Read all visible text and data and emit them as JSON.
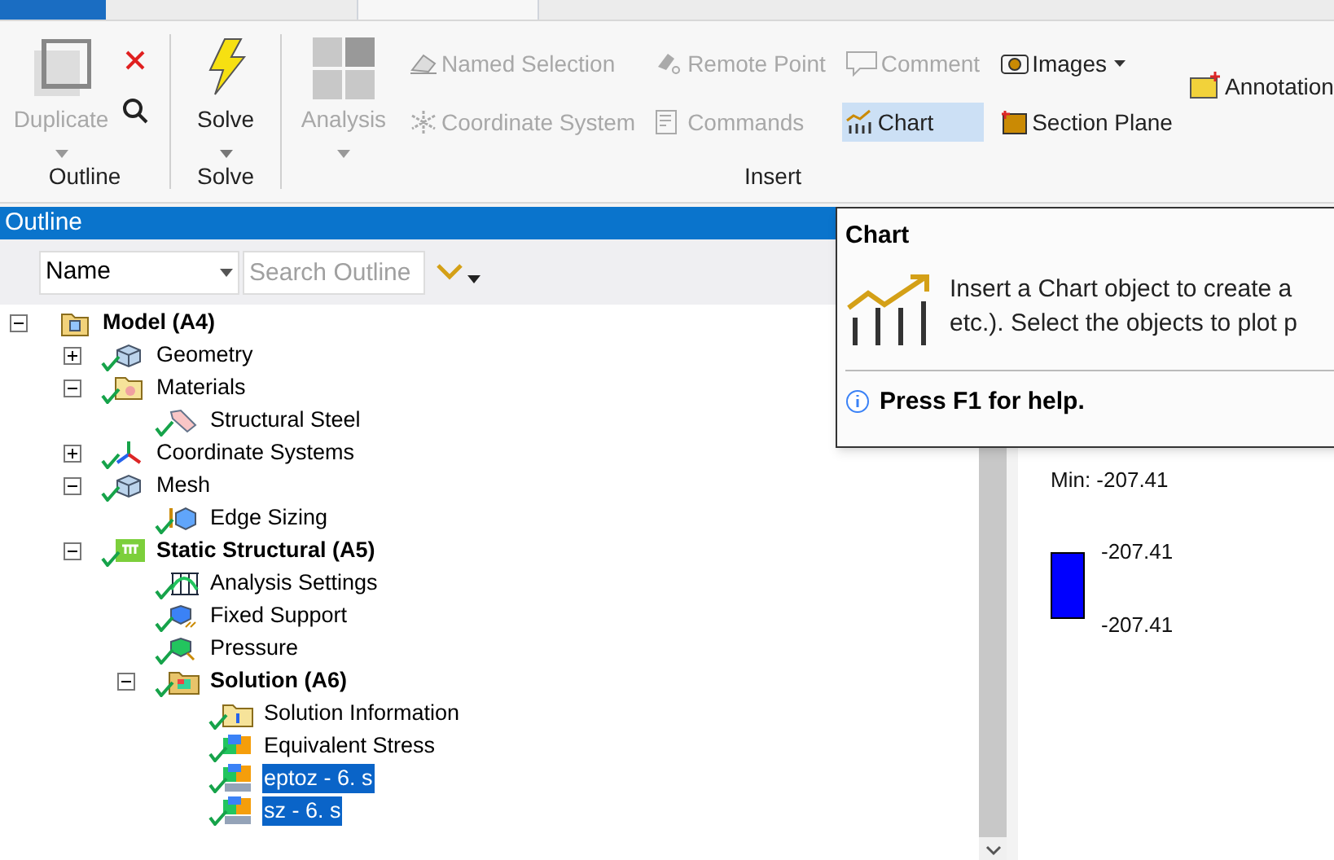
{
  "ribbon": {
    "outline_group": {
      "label": "Outline",
      "duplicate": {
        "label": "Duplicate",
        "disabled": true
      }
    },
    "solve_group": {
      "label": "Solve",
      "solve": {
        "label": "Solve",
        "disabled": false
      }
    },
    "insert_group": {
      "label": "Insert",
      "analysis": {
        "label": "Analysis",
        "disabled": true
      },
      "items": [
        {
          "label": "Named Selection",
          "kind": "named",
          "disabled": true,
          "selected": false
        },
        {
          "label": "Remote Point",
          "kind": "remote",
          "disabled": true,
          "selected": false
        },
        {
          "label": "Comment",
          "kind": "comment",
          "disabled": true,
          "selected": false
        },
        {
          "label": "Images",
          "kind": "images",
          "disabled": false,
          "selected": false
        },
        {
          "label": "Coordinate System",
          "kind": "coord",
          "disabled": true,
          "selected": false
        },
        {
          "label": "Commands",
          "kind": "commands",
          "disabled": true,
          "selected": false
        },
        {
          "label": "Chart",
          "kind": "chart",
          "disabled": false,
          "selected": true
        },
        {
          "label": "Section Plane",
          "kind": "section",
          "disabled": false,
          "selected": false
        }
      ],
      "annotation": {
        "label": "Annotation"
      }
    }
  },
  "outline": {
    "title": "Outline",
    "filter": {
      "value": "Name"
    },
    "search": {
      "placeholder": "Search Outline"
    },
    "tree": [
      {
        "label": "Model (A4)",
        "kind": "model",
        "bold": true,
        "solved": false,
        "expanded": true,
        "selected": false,
        "children": [
          {
            "label": "Geometry",
            "kind": "geometry",
            "bold": false,
            "solved": true,
            "expanded": false,
            "selected": false
          },
          {
            "label": "Materials",
            "kind": "materials",
            "bold": false,
            "solved": true,
            "expanded": true,
            "selected": false,
            "children": [
              {
                "label": "Structural Steel",
                "kind": "tag",
                "bold": false,
                "solved": true,
                "selected": false
              }
            ]
          },
          {
            "label": "Coordinate Systems",
            "kind": "coord",
            "bold": false,
            "solved": true,
            "expanded": false,
            "selected": false
          },
          {
            "label": "Mesh",
            "kind": "geometry",
            "bold": false,
            "solved": true,
            "expanded": true,
            "selected": false,
            "children": [
              {
                "label": "Edge Sizing",
                "kind": "sizing",
                "bold": false,
                "solved": true,
                "selected": false
              }
            ]
          },
          {
            "label": "Static Structural (A5)",
            "kind": "static",
            "bold": true,
            "solved": true,
            "expanded": true,
            "selected": false,
            "children": [
              {
                "label": "Analysis Settings",
                "kind": "settings",
                "bold": false,
                "solved": true,
                "selected": false
              },
              {
                "label": "Fixed Support",
                "kind": "support",
                "bold": false,
                "solved": true,
                "selected": false
              },
              {
                "label": "Pressure",
                "kind": "pressure",
                "bold": false,
                "solved": true,
                "selected": false
              },
              {
                "label": "Solution (A6)",
                "kind": "solution",
                "bold": true,
                "solved": true,
                "expanded": true,
                "selected": false,
                "children": [
                  {
                    "label": "Solution Information",
                    "kind": "info",
                    "bold": false,
                    "solved": true,
                    "selected": false
                  },
                  {
                    "label": "Equivalent Stress",
                    "kind": "result",
                    "bold": false,
                    "solved": true,
                    "selected": false
                  },
                  {
                    "label": "eptoz - 6. s",
                    "kind": "user",
                    "bold": false,
                    "solved": true,
                    "selected": true
                  },
                  {
                    "label": "sz - 6. s",
                    "kind": "user",
                    "bold": false,
                    "solved": true,
                    "selected": true
                  }
                ]
              }
            ]
          }
        ]
      }
    ]
  },
  "legend": {
    "min_label": "Min: -207.41",
    "color": "#0000ff",
    "top_value": "-207.41",
    "bottom_value": "-207.41"
  },
  "tooltip": {
    "title": "Chart",
    "lines": [
      "Insert a Chart object to create a",
      "etc.). Select the objects to plot p"
    ],
    "help": "Press F1 for help."
  }
}
